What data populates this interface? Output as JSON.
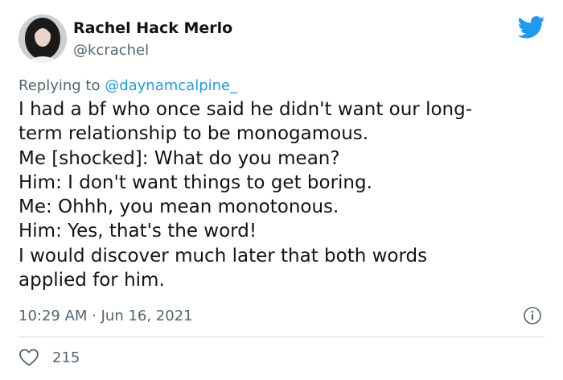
{
  "author": {
    "name": "Rachel Hack Merlo",
    "handle": "@kcrachel",
    "avatar_icon": "profile-photo"
  },
  "brand": {
    "logo_icon": "twitter-bird-icon",
    "color": "#1d9bf0"
  },
  "reply": {
    "prefix": "Replying to ",
    "mention": "@daynamcalpine_"
  },
  "tweet": {
    "lines": [
      "I had a bf who once said he didn't want our long-",
      "term relationship to be monogamous.",
      "Me [shocked]: What do you mean?",
      "Him: I don't want things to get boring.",
      "Me: Ohhh, you mean monotonous.",
      "Him: Yes, that's the word!",
      "I would discover much later that both words",
      "applied for him."
    ]
  },
  "meta": {
    "timestamp": "10:29 AM · Jun 16, 2021",
    "info_icon": "info-icon"
  },
  "actions": {
    "likes": "215",
    "like_icon": "heart-icon"
  }
}
